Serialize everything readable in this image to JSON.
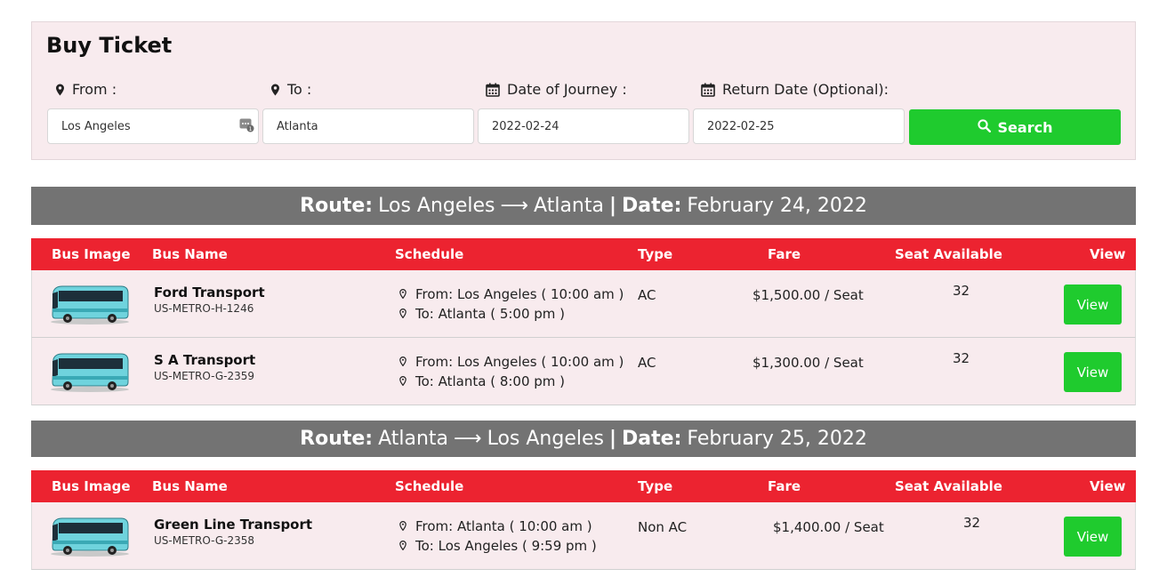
{
  "search": {
    "title": "Buy Ticket",
    "from_label": "From :",
    "from_value": "Los Angeles",
    "to_label": "To :",
    "to_value": "Atlanta",
    "date_label": "Date of Journey :",
    "date_value": "2022-02-24",
    "return_label": "Return Date (Optional):",
    "return_value": "2022-02-25",
    "search_label": "Search"
  },
  "colors": {
    "accent_green": "#1fcb2e",
    "header_red": "#ec2330",
    "banner_gray": "#737373",
    "panel_pink": "#f8ebee"
  },
  "columns": {
    "bus_image": "Bus Image",
    "bus_name": "Bus Name",
    "schedule": "Schedule",
    "type": "Type",
    "fare": "Fare",
    "seat": "Seat Available",
    "view": "View"
  },
  "routes": [
    {
      "route_label": "Route:",
      "route_from": "Los Angeles",
      "arrow": "⟶",
      "route_to": "Atlanta",
      "sep": "|",
      "date_label": "Date:",
      "date": "February 24, 2022",
      "buses": [
        {
          "name": "Ford Transport",
          "code": "US-METRO-H-1246",
          "from": "From: Los Angeles ( 10:00 am )",
          "to": "To: Atlanta ( 5:00 pm )",
          "type": "AC",
          "fare": "$1,500.00 / Seat",
          "seats": "32",
          "view": "View"
        },
        {
          "name": "S A Transport",
          "code": "US-METRO-G-2359",
          "from": "From: Los Angeles ( 10:00 am )",
          "to": "To: Atlanta ( 8:00 pm )",
          "type": "AC",
          "fare": "$1,300.00 / Seat",
          "seats": "32",
          "view": "View"
        }
      ]
    },
    {
      "route_label": "Route:",
      "route_from": "Atlanta",
      "arrow": "⟶",
      "route_to": "Los Angeles",
      "sep": "|",
      "date_label": "Date:",
      "date": "February 25, 2022",
      "buses": [
        {
          "name": "Green Line Transport",
          "code": "US-METRO-G-2358",
          "from": "From: Atlanta ( 10:00 am )",
          "to": "To: Los Angeles ( 9:59 pm )",
          "type": "Non AC",
          "fare": "$1,400.00 / Seat",
          "seats": "32",
          "view": "View"
        }
      ]
    }
  ]
}
